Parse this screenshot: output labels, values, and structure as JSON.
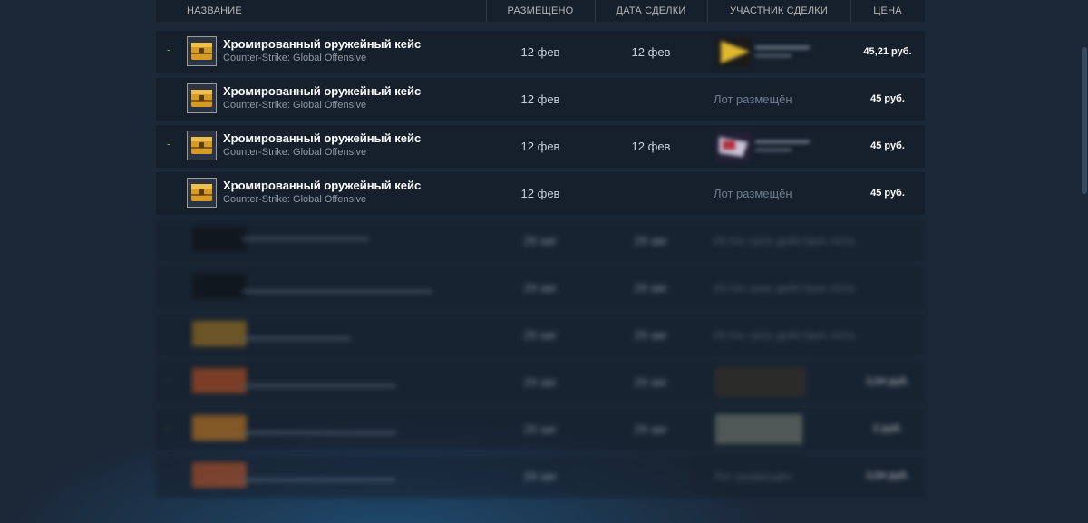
{
  "header": {
    "name": "НАЗВАНИЕ",
    "listed": "РАЗМЕЩЕНО",
    "acted": "ДАТА СДЕЛКИ",
    "actor": "УЧАСТНИК СДЕЛКИ",
    "price": "ЦЕНА"
  },
  "rows": [
    {
      "gain": "-",
      "name": "Хромированный оружейный кейс",
      "game": "Counter-Strike: Global Offensive",
      "listed": "12 фев",
      "acted": "12 фев",
      "status": "",
      "price": "45,21 руб."
    },
    {
      "gain": "",
      "name": "Хромированный оружейный кейс",
      "game": "Counter-Strike: Global Offensive",
      "listed": "12 фев",
      "acted": "",
      "status": "Лот размещён",
      "price": "45 руб."
    },
    {
      "gain": "-",
      "name": "Хромированный оружейный кейс",
      "game": "Counter-Strike: Global Offensive",
      "listed": "12 фев",
      "acted": "12 фев",
      "status": "",
      "price": "45 руб."
    },
    {
      "gain": "",
      "name": "Хромированный оружейный кейс",
      "game": "Counter-Strike: Global Offensive",
      "listed": "12 фев",
      "acted": "",
      "status": "Лот размещён",
      "price": "45 руб."
    }
  ],
  "blurred_rows": [
    {
      "gain": "",
      "listed": "29 авг",
      "acted": "29 авг",
      "status": "Истек срок действия лота",
      "price": ""
    },
    {
      "gain": "",
      "listed": "29 авг",
      "acted": "29 авг",
      "status": "Истек срок действия лота",
      "price": ""
    },
    {
      "gain": "",
      "listed": "29 авг",
      "acted": "29 авг",
      "status": "Истек срок действия лота",
      "price": ""
    },
    {
      "gain": "-",
      "listed": "29 авг",
      "acted": "29 авг",
      "status": "",
      "price": "2,04 руб."
    },
    {
      "gain": "-",
      "listed": "29 авг",
      "acted": "29 авг",
      "status": "",
      "price": "2 руб."
    },
    {
      "gain": "",
      "listed": "29 авг",
      "acted": "",
      "status": "Лот размещён",
      "price": "2,04 руб."
    }
  ],
  "colors": {
    "background": "#1b2838",
    "row": "#16202d",
    "gain": "#7fba3a",
    "case_gold": "#d69a26"
  },
  "icons": {
    "case": "weapon-case-icon",
    "avatar": "user-avatar-icon"
  }
}
